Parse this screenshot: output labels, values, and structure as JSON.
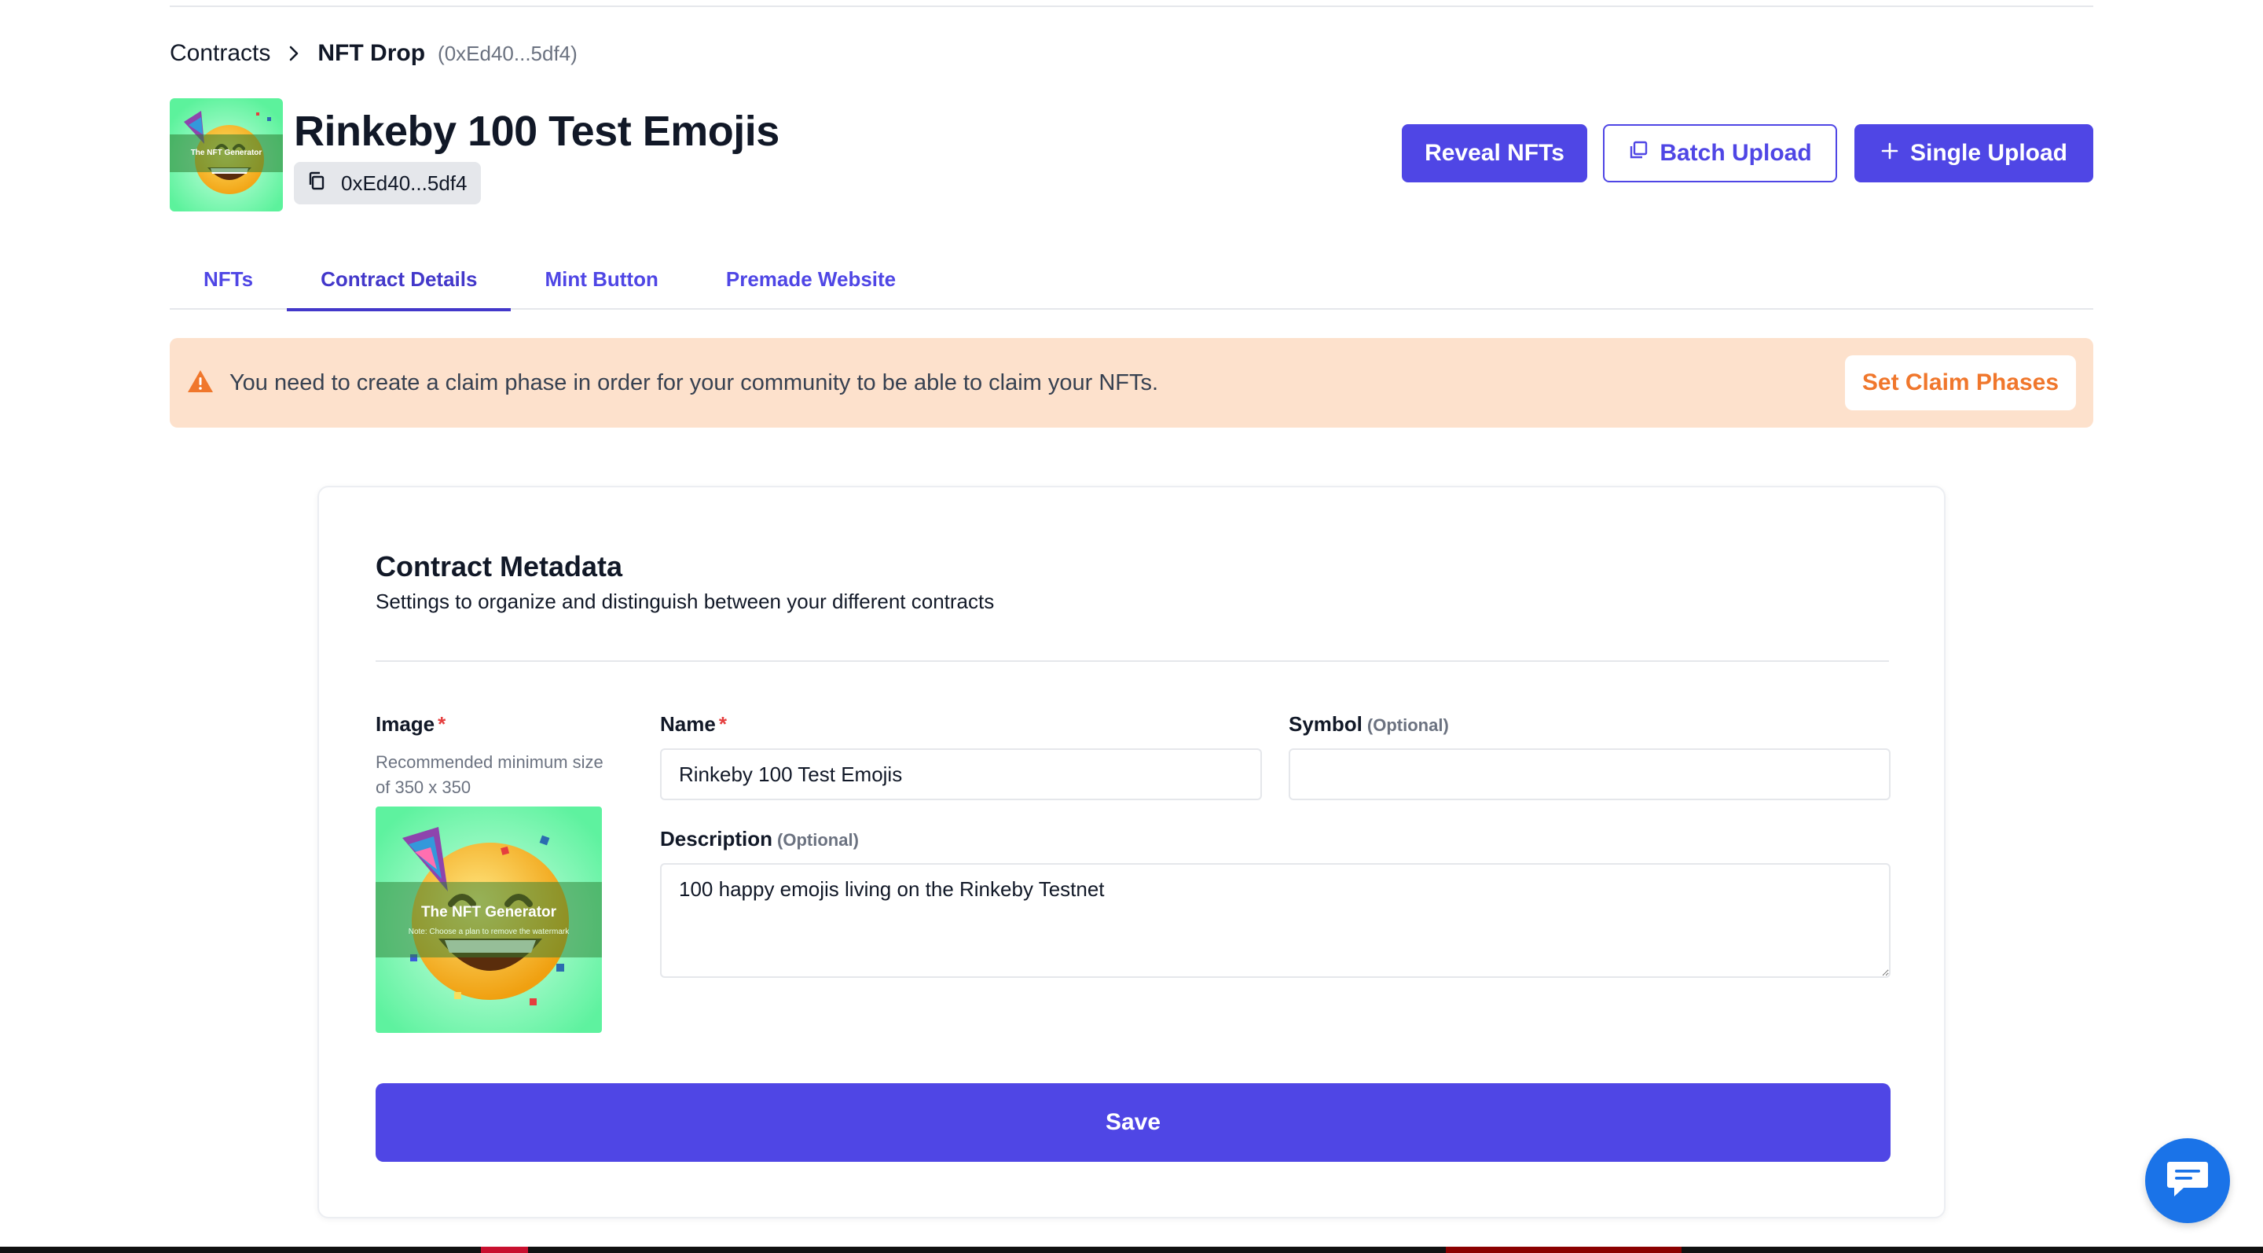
{
  "breadcrumb": {
    "parent": "Contracts",
    "current": "NFT Drop",
    "address": "(0xEd40...5df4)"
  },
  "header": {
    "title": "Rinkeby 100 Test Emojis",
    "address_chip": "0xEd40...5df4",
    "thumbnail_watermark": "The NFT Generator"
  },
  "actions": {
    "reveal_label": "Reveal NFTs",
    "batch_label": "Batch Upload",
    "single_label": "Single Upload"
  },
  "tabs": [
    {
      "label": "NFTs",
      "active": false
    },
    {
      "label": "Contract Details",
      "active": true
    },
    {
      "label": "Mint Button",
      "active": false
    },
    {
      "label": "Premade Website",
      "active": false
    }
  ],
  "alert": {
    "message": "You need to create a claim phase in order for your community to be able to claim your NFTs.",
    "button_label": "Set Claim Phases"
  },
  "card": {
    "title": "Contract Metadata",
    "subtitle": "Settings to organize and distinguish between your different contracts",
    "image_label": "Image",
    "image_hint": "Recommended minimum size of 350 x 350",
    "image_watermark": "The NFT Generator",
    "image_watermark_note": "Note: Choose a plan to remove the watermark",
    "name_label": "Name",
    "name_value": "Rinkeby 100 Test Emojis",
    "symbol_label": "Symbol",
    "symbol_value": "",
    "optional_tag": "(Optional)",
    "required_mark": "*",
    "description_label": "Description",
    "description_value": "100 happy emojis living on the Rinkeby Testnet",
    "save_label": "Save"
  },
  "colors": {
    "primary": "#4f46e5",
    "alert_bg": "#fde1cc",
    "alert_accent": "#f0772c",
    "chat": "#1a73e8"
  }
}
